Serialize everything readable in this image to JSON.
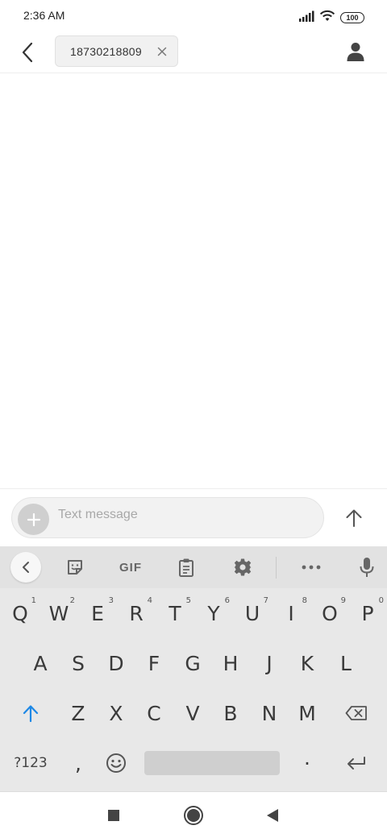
{
  "status_bar": {
    "time": "2:36 AM",
    "battery": "100",
    "icons": [
      "signal-icon",
      "wifi-icon",
      "battery-icon"
    ]
  },
  "header": {
    "back_icon": "chevron-left-icon",
    "recipient": "18730218809",
    "remove_icon": "close-icon",
    "contact_icon": "person-icon"
  },
  "compose": {
    "placeholder": "Text message",
    "attach_icon": "plus-icon",
    "send_icon": "arrow-up-icon"
  },
  "keyboard": {
    "toolbar": {
      "back_icon": "chevron-left-icon",
      "sticker_icon": "sticker-icon",
      "gif_label": "GIF",
      "clipboard_icon": "clipboard-icon",
      "settings_icon": "gear-icon",
      "more_icon": "more-horizontal-icon",
      "mic_icon": "microphone-icon"
    },
    "row1": [
      {
        "key": "Q",
        "hint": "1"
      },
      {
        "key": "W",
        "hint": "2"
      },
      {
        "key": "E",
        "hint": "3"
      },
      {
        "key": "R",
        "hint": "4"
      },
      {
        "key": "T",
        "hint": "5"
      },
      {
        "key": "Y",
        "hint": "6"
      },
      {
        "key": "U",
        "hint": "7"
      },
      {
        "key": "I",
        "hint": "8"
      },
      {
        "key": "O",
        "hint": "9"
      },
      {
        "key": "P",
        "hint": "0"
      }
    ],
    "row2": [
      "A",
      "S",
      "D",
      "F",
      "G",
      "H",
      "J",
      "K",
      "L"
    ],
    "row3": [
      "Z",
      "X",
      "C",
      "V",
      "B",
      "N",
      "M"
    ],
    "row4": {
      "symbols": "?123",
      "comma": ",",
      "period": "·"
    },
    "shift_icon": "shift-arrow-icon",
    "backspace_icon": "backspace-icon",
    "emoji_icon": "emoji-icon",
    "enter_icon": "enter-icon",
    "accent_color": "#1e88e5"
  },
  "nav_bar": {
    "recents_icon": "square-icon",
    "home_icon": "circle-icon",
    "back_icon": "triangle-back-icon"
  }
}
